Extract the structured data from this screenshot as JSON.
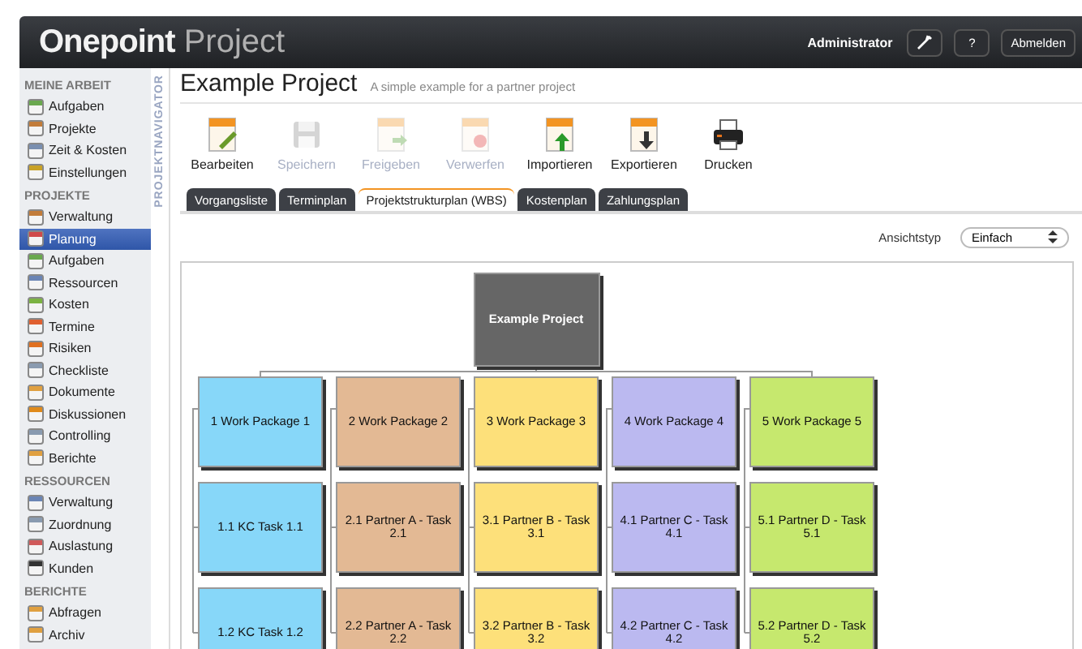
{
  "header": {
    "logo_bold": "Onepoint",
    "logo_light": "Project",
    "user": "Administrator",
    "help_button": "?",
    "logout_button": "Abmelden"
  },
  "sidebar": {
    "sections": [
      {
        "title": "MEINE ARBEIT",
        "items": [
          {
            "label": "Aufgaben",
            "selected": false
          },
          {
            "label": "Projekte",
            "selected": false
          },
          {
            "label": "Zeit & Kosten",
            "selected": false
          },
          {
            "label": "Einstellungen",
            "selected": false
          }
        ]
      },
      {
        "title": "PROJEKTE",
        "items": [
          {
            "label": "Verwaltung",
            "selected": false
          },
          {
            "label": "Planung",
            "selected": true
          },
          {
            "label": "Aufgaben",
            "selected": false
          },
          {
            "label": "Ressourcen",
            "selected": false
          },
          {
            "label": "Kosten",
            "selected": false
          },
          {
            "label": "Termine",
            "selected": false
          },
          {
            "label": "Risiken",
            "selected": false
          },
          {
            "label": "Checkliste",
            "selected": false
          },
          {
            "label": "Dokumente",
            "selected": false
          },
          {
            "label": "Diskussionen",
            "selected": false
          },
          {
            "label": "Controlling",
            "selected": false
          },
          {
            "label": "Berichte",
            "selected": false
          }
        ]
      },
      {
        "title": "RESSOURCEN",
        "items": [
          {
            "label": "Verwaltung",
            "selected": false
          },
          {
            "label": "Zuordnung",
            "selected": false
          },
          {
            "label": "Auslastung",
            "selected": false
          },
          {
            "label": "Kunden",
            "selected": false
          }
        ]
      },
      {
        "title": "BERICHTE",
        "items": [
          {
            "label": "Abfragen",
            "selected": false
          },
          {
            "label": "Archiv",
            "selected": false
          }
        ]
      }
    ]
  },
  "navigator_label": "PROJEKTNAVIGATOR",
  "page": {
    "title": "Example Project",
    "subtitle": "A simple example for a partner project"
  },
  "toolbar": [
    {
      "label": "Bearbeiten",
      "disabled": false
    },
    {
      "label": "Speichern",
      "disabled": true
    },
    {
      "label": "Freigeben",
      "disabled": true
    },
    {
      "label": "Verwerfen",
      "disabled": true
    },
    {
      "label": "Importieren",
      "disabled": false
    },
    {
      "label": "Exportieren",
      "disabled": false
    },
    {
      "label": "Drucken",
      "disabled": false
    }
  ],
  "tabs": [
    {
      "label": "Vorgangsliste",
      "selected": false
    },
    {
      "label": "Terminplan",
      "selected": false
    },
    {
      "label": "Projektstrukturplan (WBS)",
      "selected": true
    },
    {
      "label": "Kostenplan",
      "selected": false
    },
    {
      "label": "Zahlungsplan",
      "selected": false
    }
  ],
  "view_type": {
    "label": "Ansichtstyp",
    "value": "Einfach"
  },
  "wbs": {
    "root": "Example Project",
    "packages": [
      {
        "label": "1 Work Package 1",
        "color": "#87d7f9",
        "children": [
          {
            "label": "1.1 KC Task 1.1"
          },
          {
            "label": "1.2 KC Task 1.2"
          }
        ]
      },
      {
        "label": "2 Work Package 2",
        "color": "#e3b994",
        "children": [
          {
            "label": "2.1 Partner A - Task 2.1"
          },
          {
            "label": "2.2 Partner A - Task 2.2"
          }
        ]
      },
      {
        "label": "3 Work Package 3",
        "color": "#fde07a",
        "children": [
          {
            "label": "3.1 Partner B - Task 3.1"
          },
          {
            "label": "3.2 Partner B - Task 3.2"
          }
        ]
      },
      {
        "label": "4 Work Package 4",
        "color": "#bbb9f0",
        "children": [
          {
            "label": "4.1 Partner C - Task 4.1"
          },
          {
            "label": "4.2 Partner C - Task 4.2"
          }
        ]
      },
      {
        "label": "5 Work Package 5",
        "color": "#c6e86e",
        "children": [
          {
            "label": "5.1 Partner D - Task 5.1"
          },
          {
            "label": "5.2 Partner D - Task 5.2"
          }
        ]
      }
    ]
  }
}
